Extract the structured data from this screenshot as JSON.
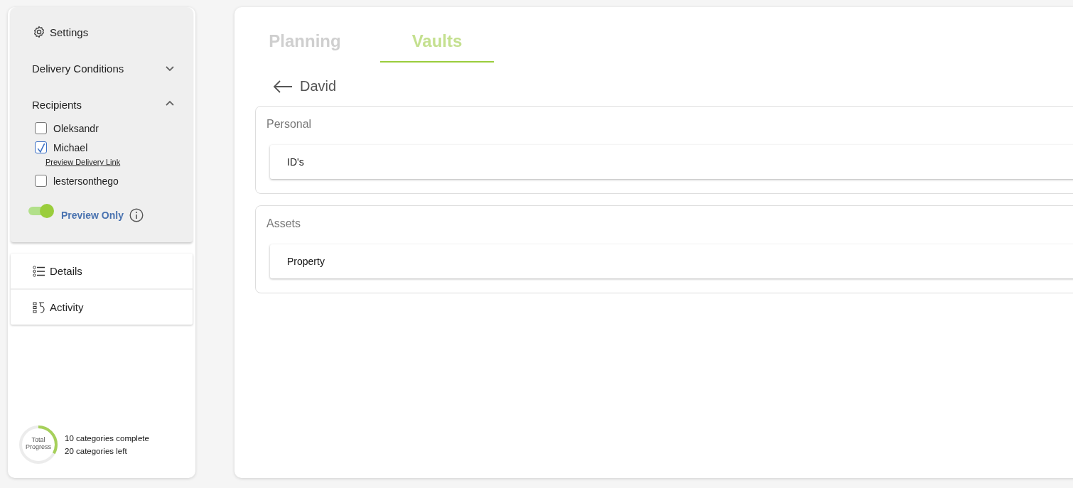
{
  "sidebar": {
    "settings": {
      "title": "Settings"
    },
    "sections": [
      {
        "title": "Delivery Conditions",
        "expanded": false
      },
      {
        "title": "Recipients",
        "expanded": true
      }
    ],
    "recipients": [
      {
        "name": "Oleksandr",
        "checked": false
      },
      {
        "name": "Michael",
        "checked": true,
        "link": "Preview Delivery Link"
      },
      {
        "name": "lestersonthego",
        "checked": false
      }
    ],
    "preview_toggle": {
      "label": "Preview Only",
      "on": true
    },
    "nav": [
      {
        "label": "Details",
        "kind": "details"
      },
      {
        "label": "Activity",
        "kind": "activity"
      }
    ],
    "progress": {
      "label": "Total Progress",
      "level": 0.33,
      "complete": "10 categories complete",
      "left": "20 categories left"
    }
  },
  "tabs": [
    {
      "label": "Planning",
      "selected": false
    },
    {
      "label": "Vaults",
      "selected": true
    }
  ],
  "back": {
    "title": "David"
  },
  "groups": [
    {
      "title": "Personal",
      "items": [
        "ID's"
      ]
    },
    {
      "title": "Assets",
      "items": [
        "Property"
      ]
    }
  ]
}
